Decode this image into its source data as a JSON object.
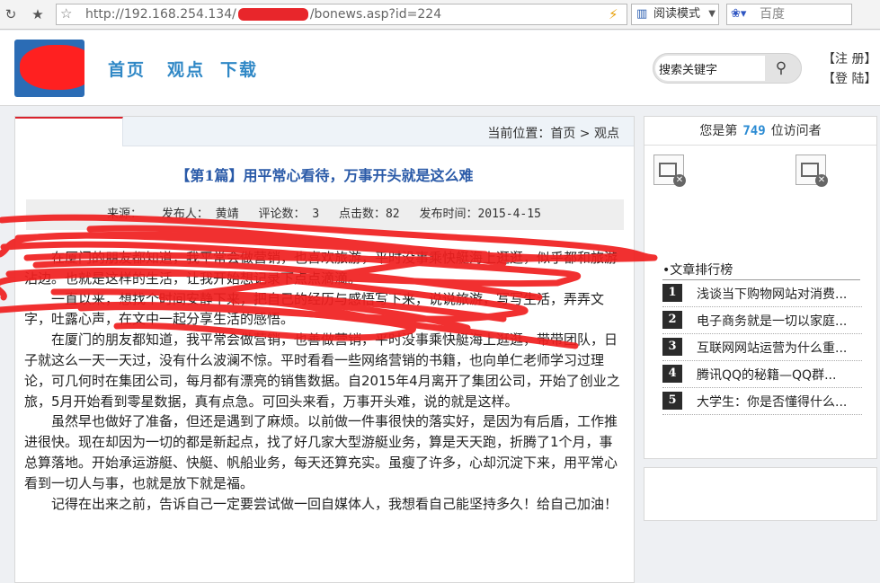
{
  "browser": {
    "url_prefix": "http://192.168.254.134/",
    "url_suffix": "/bonews.asp?id=224",
    "reading_mode": "阅读模式",
    "search_placeholder": "百度"
  },
  "header": {
    "nav": [
      "首页",
      "观点",
      "下载"
    ],
    "search_value": "搜索关键字",
    "register": "【注 册】",
    "login": "【登 陆】"
  },
  "article": {
    "breadcrumb": "当前位置：首页 > 观点",
    "title": "【第1篇】用平常心看待，万事开头就是这么难",
    "meta": {
      "source": "来源：",
      "author": "发布人： 黄靖",
      "comments": "评论数： 3",
      "clicks": "点击数：82",
      "date": "发布时间：2015-4-15"
    },
    "paragraphs": [
      "在厦门的朋友都知道，我平常会做营销，也喜欢旅游，平时没事乘快艇海上逛逛，似乎都和旅游沾边。也就是这样的生活，让我开始想记录下点点滴滴。",
      "一直以来，想找个时间安静下来，把自己的经历与感悟写下来，说说旅游，写写生活，弄弄文字，吐露心声，在文中一起分享生活的感悟。",
      "在厦门的朋友都知道，我平常会做营销，也善做营销，平时没事乘快艇海上逛逛，带带团队，日子就这么一天一天过，没有什么波澜不惊。平时看看一些网络营销的书籍，也向单仁老师学习过理论，可几何时在集团公司，每月都有漂亮的销售数据。自2015年4月离开了集团公司，开始了创业之旅，5月开始看到零星数据，真有点急。可回头来看，万事开头难，说的就是这样。",
      "虽然早也做好了准备，但还是遇到了麻烦。以前做一件事很快的落实好，是因为有后盾，工作推进很快。现在却因为一切的都是新起点，找了好几家大型游艇业务，算是天天跑，折腾了1个月，事总算落地。开始承运游艇、快艇、帆船业务，每天还算充实。虽瘦了许多，心却沉淀下来，用平常心看到一切人与事，也就是放下就是福。",
      "记得在出来之前，告诉自己一定要尝试做一回自媒体人，我想看自己能坚持多久！给自己加油！"
    ]
  },
  "sidebar": {
    "visitor_prefix": "您是第",
    "visitor_count": "749",
    "visitor_suffix": "位访问者",
    "ranking_title": "•文章排行榜",
    "ranking": [
      {
        "num": "1",
        "title": "浅谈当下购物网站对消费..."
      },
      {
        "num": "2",
        "title": "电子商务就是一切以家庭..."
      },
      {
        "num": "3",
        "title": "互联网网站运营为什么重..."
      },
      {
        "num": "4",
        "title": "腾讯QQ的秘籍—QQ群..."
      },
      {
        "num": "5",
        "title": "大学生：你是否懂得什么..."
      }
    ]
  },
  "colors": {
    "accent": "#3088c6",
    "title": "#2a5aa8",
    "redaction": "#ff2020"
  }
}
